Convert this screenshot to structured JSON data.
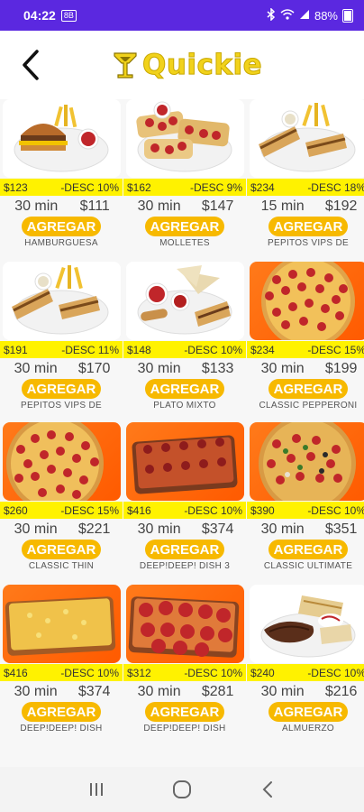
{
  "status": {
    "time": "04:22",
    "mini_icon": "8B",
    "battery": "88%"
  },
  "header": {
    "app_name": "Quickie"
  },
  "products": [
    {
      "price": "$123",
      "discount": "-DESC 10%",
      "time": "30 min",
      "final": "$111",
      "button": "AGREGAR",
      "name": "HAMBURGUESA",
      "image": "burger-fries"
    },
    {
      "price": "$162",
      "discount": "-DESC 9%",
      "time": "30 min",
      "final": "$147",
      "button": "AGREGAR",
      "name": "MOLLETES",
      "image": "molletes"
    },
    {
      "price": "$234",
      "discount": "-DESC 18%",
      "time": "15 min",
      "final": "$192",
      "button": "AGREGAR",
      "name": "PEPITOS VIPS DE",
      "image": "sandwich-fries"
    },
    {
      "price": "$191",
      "discount": "-DESC 11%",
      "time": "30 min",
      "final": "$170",
      "button": "AGREGAR",
      "name": "PEPITOS VIPS DE",
      "image": "sandwich-fries"
    },
    {
      "price": "$148",
      "discount": "-DESC 10%",
      "time": "30 min",
      "final": "$133",
      "button": "AGREGAR",
      "name": "PLATO MIXTO",
      "image": "mixed-plate"
    },
    {
      "price": "$234",
      "discount": "-DESC 15%",
      "time": "30 min",
      "final": "$199",
      "button": "AGREGAR",
      "name": "CLASSIC PEPPERONI",
      "image": "pizza-pepperoni"
    },
    {
      "price": "$260",
      "discount": "-DESC 15%",
      "time": "30 min",
      "final": "$221",
      "button": "AGREGAR",
      "name": "CLASSIC THIN",
      "image": "pizza-thin"
    },
    {
      "price": "$416",
      "discount": "-DESC 10%",
      "time": "30 min",
      "final": "$374",
      "button": "AGREGAR",
      "name": "DEEP!DEEP! DISH 3",
      "image": "pizza-deep"
    },
    {
      "price": "$390",
      "discount": "-DESC 10%",
      "time": "30 min",
      "final": "$351",
      "button": "AGREGAR",
      "name": "CLASSIC ULTIMATE",
      "image": "pizza-ultimate"
    },
    {
      "price": "$416",
      "discount": "-DESC 10%",
      "time": "30 min",
      "final": "$374",
      "button": "AGREGAR",
      "name": "DEEP!DEEP! DISH",
      "image": "pizza-deep-cheese"
    },
    {
      "price": "$312",
      "discount": "-DESC 10%",
      "time": "30 min",
      "final": "$281",
      "button": "AGREGAR",
      "name": "DEEP!DEEP! DISH",
      "image": "pizza-deep-pepperoni"
    },
    {
      "price": "$240",
      "discount": "-DESC 10%",
      "time": "30 min",
      "final": "$216",
      "button": "AGREGAR",
      "name": "ALMUERZO",
      "image": "beef-plate"
    }
  ],
  "icons": {
    "back": "back-arrow-icon",
    "logo": "cocktail-glass-icon",
    "recents": "recent-apps-icon",
    "home": "home-circle-icon",
    "nav_back": "nav-back-icon"
  },
  "colors": {
    "status_bar": "#5b28e0",
    "brand_yellow": "#f1d21b",
    "price_strip": "#fff200",
    "button": "#f7b900",
    "pizza_bg": "#ff6a0a"
  }
}
